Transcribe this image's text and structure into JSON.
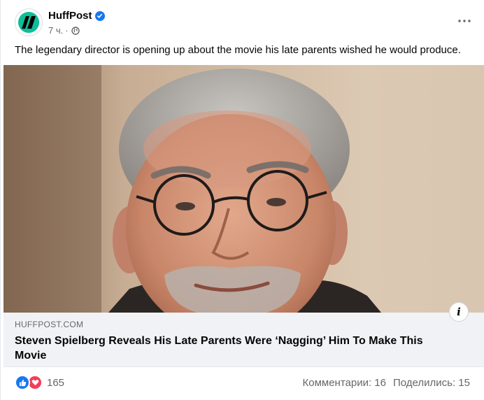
{
  "header": {
    "page_name": "HuffPost",
    "time": "7 ч.",
    "separator": "·"
  },
  "post": {
    "caption": "The legendary director is opening up about the movie his late parents wished he would produce."
  },
  "link_preview": {
    "domain": "HUFFPOST.COM",
    "headline": "Steven Spielberg Reveals His Late Parents Were ‘Nagging’ Him To Make This Movie",
    "info_icon": "i"
  },
  "footer": {
    "reaction_count": "165",
    "comments": "Комментарии: 16",
    "shares": "Поделились: 15"
  },
  "colors": {
    "accent": "#1877f2",
    "love": "#f33e58",
    "brand": "#0dbe98",
    "secondary_text": "#65676b",
    "link_box_bg": "#f0f2f5"
  },
  "icons": [
    "huffpost-logo-icon",
    "verified-badge-icon",
    "globe-icon",
    "more-options-icon",
    "info-icon",
    "like-reaction-icon",
    "love-reaction-icon"
  ]
}
